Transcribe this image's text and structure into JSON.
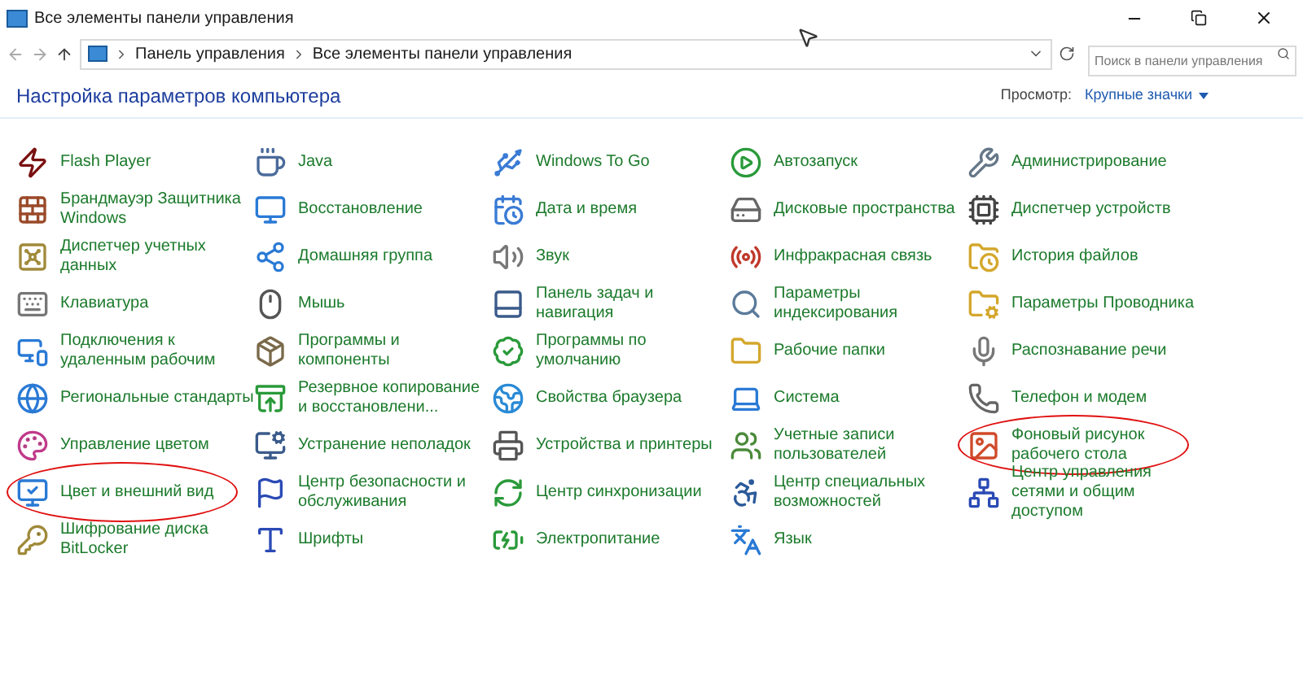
{
  "window": {
    "title": "Все элементы панели управления"
  },
  "address_bar": {
    "breadcrumbs": [
      "Панель управления",
      "Все элементы панели управления"
    ]
  },
  "search": {
    "placeholder": "Поиск в панели управления"
  },
  "heading": "Настройка параметров компьютера",
  "view": {
    "label": "Просмотр:",
    "value": "Крупные значки"
  },
  "items": [
    {
      "label": "Flash Player",
      "highlighted": false
    },
    {
      "label": "Java",
      "highlighted": false
    },
    {
      "label": "Windows To Go",
      "highlighted": false
    },
    {
      "label": "Автозапуск",
      "highlighted": false
    },
    {
      "label": "Администрирование",
      "highlighted": false
    },
    {
      "label": "Брандмауэр Защитника Windows",
      "highlighted": false
    },
    {
      "label": "Восстановление",
      "highlighted": false
    },
    {
      "label": "Дата и время",
      "highlighted": false
    },
    {
      "label": "Дисковые пространства",
      "highlighted": false
    },
    {
      "label": "Диспетчер устройств",
      "highlighted": false
    },
    {
      "label": "Диспетчер учетных данных",
      "highlighted": false
    },
    {
      "label": "Домашняя группа",
      "highlighted": false
    },
    {
      "label": "Звук",
      "highlighted": false
    },
    {
      "label": "Инфракрасная связь",
      "highlighted": false
    },
    {
      "label": "История файлов",
      "highlighted": false
    },
    {
      "label": "Клавиатура",
      "highlighted": false
    },
    {
      "label": "Мышь",
      "highlighted": false
    },
    {
      "label": "Панель задач и навигация",
      "highlighted": false
    },
    {
      "label": "Параметры индексирования",
      "highlighted": false
    },
    {
      "label": "Параметры Проводника",
      "highlighted": false
    },
    {
      "label": "Подключения к удаленным рабочим",
      "highlighted": false
    },
    {
      "label": "Программы и компоненты",
      "highlighted": false
    },
    {
      "label": "Программы по умолчанию",
      "highlighted": false
    },
    {
      "label": "Рабочие папки",
      "highlighted": false
    },
    {
      "label": "Распознавание речи",
      "highlighted": false
    },
    {
      "label": "Региональные стандарты",
      "highlighted": false
    },
    {
      "label": "Резервное копирование и восстановлени...",
      "highlighted": false
    },
    {
      "label": "Свойства браузера",
      "highlighted": false
    },
    {
      "label": "Система",
      "highlighted": false
    },
    {
      "label": "Телефон и модем",
      "highlighted": false
    },
    {
      "label": "Управление цветом",
      "highlighted": false
    },
    {
      "label": "Устранение неполадок",
      "highlighted": false
    },
    {
      "label": "Устройства и принтеры",
      "highlighted": false
    },
    {
      "label": "Учетные записи пользователей",
      "highlighted": false
    },
    {
      "label": "Фоновый рисунок рабочего стола",
      "highlighted": true
    },
    {
      "label": "Цвет и внешний вид",
      "highlighted": true
    },
    {
      "label": "Центр безопасности и обслуживания",
      "highlighted": false
    },
    {
      "label": "Центр синхронизации",
      "highlighted": false
    },
    {
      "label": "Центр специальных возможностей",
      "highlighted": false
    },
    {
      "label": "Центр управления сетями и общим доступом",
      "highlighted": false
    },
    {
      "label": "Шифрование диска BitLocker",
      "highlighted": false
    },
    {
      "label": "Шрифты",
      "highlighted": false
    },
    {
      "label": "Электропитание",
      "highlighted": false
    },
    {
      "label": "Язык",
      "highlighted": false
    }
  ]
}
